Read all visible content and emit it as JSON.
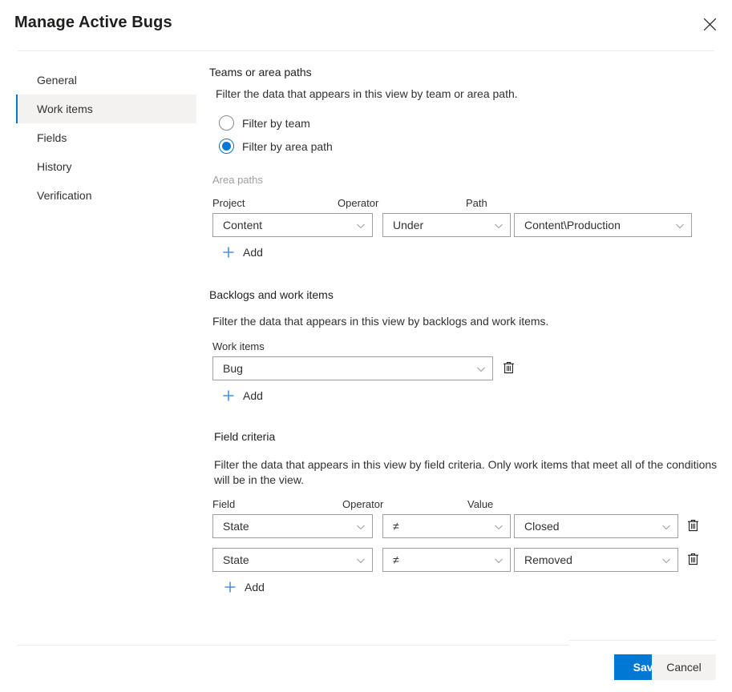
{
  "header": {
    "title": "Manage Active Bugs",
    "close_label": "Close",
    "close_icon": "close-icon"
  },
  "sidebar": {
    "items": [
      {
        "label": "General",
        "selected": false
      },
      {
        "label": "Work items",
        "selected": true
      },
      {
        "label": "Fields",
        "selected": false
      },
      {
        "label": "History",
        "selected": false
      },
      {
        "label": "Verification",
        "selected": false
      }
    ]
  },
  "teams_section": {
    "title": "Teams or area paths",
    "description": "Filter the data that appears in this view by team or area path.",
    "radios": [
      {
        "label": "Filter by team",
        "checked": false
      },
      {
        "label": "Filter by area path",
        "checked": true
      }
    ]
  },
  "area_paths": {
    "group_label": "Area paths",
    "columns": {
      "project": "Project",
      "operator": "Operator",
      "path": "Path"
    },
    "rows": [
      {
        "project": "Content",
        "operator": "Under",
        "path": "Content\\Production"
      }
    ],
    "add_label": "Add",
    "add_icon": "plus-icon"
  },
  "backlogs_section": {
    "title": "Backlogs and work items",
    "description": "Filter the data that appears in this view by backlogs and work items.",
    "work_items_label": "Work items",
    "rows": [
      {
        "value": "Bug",
        "delete_icon": "trash-icon"
      }
    ],
    "add_label": "Add",
    "add_icon": "plus-icon"
  },
  "field_criteria": {
    "title": "Field criteria",
    "description": "Filter the data that appears in this view by field criteria. Only work items that meet all of the conditions will be in the view.",
    "columns": {
      "field": "Field",
      "operator": "Operator",
      "value": "Value"
    },
    "rows": [
      {
        "field": "State",
        "operator": "≠",
        "value": "Closed",
        "delete_icon": "trash-icon"
      },
      {
        "field": "State",
        "operator": "≠",
        "value": "Removed",
        "delete_icon": "trash-icon"
      }
    ],
    "add_label": "Add",
    "add_icon": "plus-icon"
  },
  "footer": {
    "save_label": "Save",
    "cancel_label": "Cancel"
  },
  "colors": {
    "accent": "#0078d4",
    "selected_nav_bg": "#f3f2f1",
    "border": "#a19f9d",
    "divider": "#edebe9",
    "text": "#323130",
    "muted_text": "#a19f9d"
  }
}
